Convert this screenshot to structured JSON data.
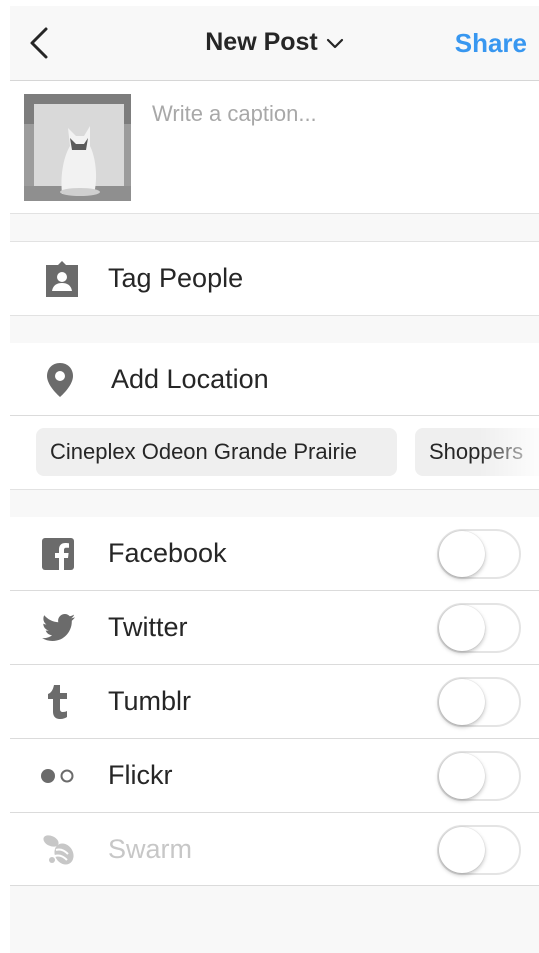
{
  "header": {
    "title": "New Post",
    "share_label": "Share"
  },
  "caption": {
    "placeholder": "Write a caption...",
    "value": ""
  },
  "tag_people": {
    "label": "Tag People",
    "icon": "tag-person-icon"
  },
  "add_location": {
    "label": "Add Location",
    "icon": "location-pin-icon"
  },
  "location_suggestions": [
    "Cineplex Odeon Grande Prairie",
    "Shoppers"
  ],
  "share_targets": [
    {
      "label": "Facebook",
      "icon": "facebook-icon",
      "enabled": false
    },
    {
      "label": "Twitter",
      "icon": "twitter-icon",
      "enabled": false
    },
    {
      "label": "Tumblr",
      "icon": "tumblr-icon",
      "enabled": false
    },
    {
      "label": "Flickr",
      "icon": "flickr-icon",
      "enabled": false
    },
    {
      "label": "Swarm",
      "icon": "swarm-icon",
      "enabled": false
    }
  ],
  "colors": {
    "accent": "#3897f0",
    "text": "#262626",
    "icon_gray": "#6b6b6b",
    "muted": "#c7c7c7",
    "separator_bg": "#f8f8f8"
  }
}
